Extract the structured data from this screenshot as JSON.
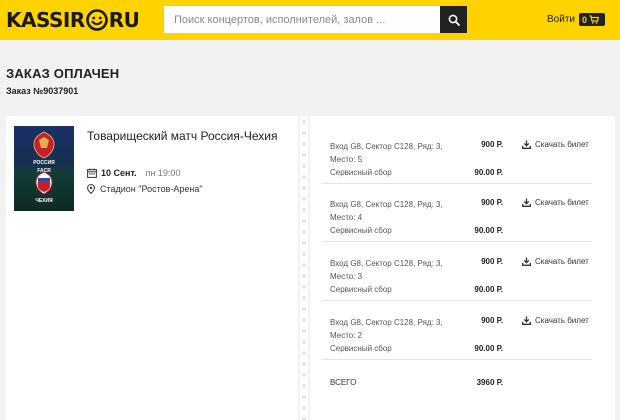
{
  "header": {
    "logo_left": "KASSIR",
    "logo_right": "RU",
    "search_placeholder": "Поиск концертов, исполнителей, залов ...",
    "login_label": "Войти",
    "cart_count": "0",
    "brand_color": "#ffd200"
  },
  "page": {
    "title": "ЗАКАЗ ОПЛАЧЕН",
    "order_number": "Заказ №9037901"
  },
  "event": {
    "title": "Товарищеский матч Россия-Чехия",
    "date": "10 Сент.",
    "weekday_time": "пн 19:00",
    "venue": "Стадион \"Ростов-Арена\"",
    "poster_top_text": "РОССИЯ",
    "poster_mid_text": "FACR",
    "poster_bottom_text": "ЧЕХИЯ"
  },
  "tickets": [
    {
      "desc": "Вход G8, Сектор C128, Ряд: 3, Место: 5",
      "price": "900 Р.",
      "fee_label": "Сервисный сбор",
      "fee": "90.00 Р.",
      "download_label": "Скачать билет"
    },
    {
      "desc": "Вход G8, Сектор C128, Ряд: 3, Место: 4",
      "price": "900 Р.",
      "fee_label": "Сервисный сбор",
      "fee": "90.00 Р.",
      "download_label": "Скачать билет"
    },
    {
      "desc": "Вход G8, Сектор C128, Ряд: 3, Место: 3",
      "price": "900 Р.",
      "fee_label": "Сервисный сбор",
      "fee": "90.00 Р.",
      "download_label": "Скачать билет"
    },
    {
      "desc": "Вход G8, Сектор C128, Ряд: 3, Место: 2",
      "price": "900 Р.",
      "fee_label": "Сервисный сбор",
      "fee": "90.00 Р.",
      "download_label": "Скачать билет"
    }
  ],
  "total": {
    "label": "ВСЕГО",
    "value": "3960 Р."
  }
}
